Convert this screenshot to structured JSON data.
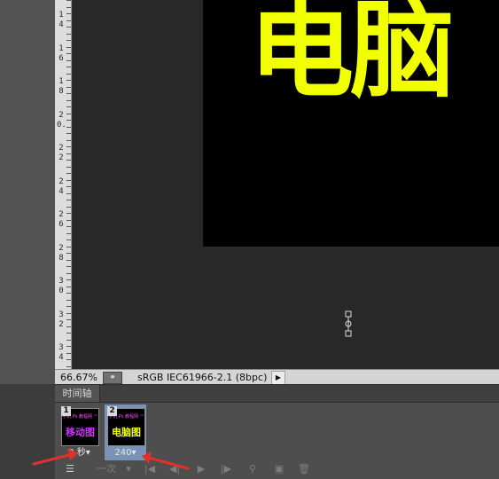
{
  "ruler": {
    "numbers": [
      {
        "a": "1",
        "b": "4"
      },
      {
        "a": "1",
        "b": "6"
      },
      {
        "a": "1",
        "b": "8"
      },
      {
        "a": "2",
        "b": "0."
      },
      {
        "a": "2",
        "b": "2"
      },
      {
        "a": "2",
        "b": "4"
      },
      {
        "a": "2",
        "b": "6"
      },
      {
        "a": "2",
        "b": "8"
      },
      {
        "a": "3",
        "b": "0"
      },
      {
        "a": "3",
        "b": "2"
      },
      {
        "a": "3",
        "b": "4"
      }
    ]
  },
  "canvas": {
    "text": "电脑",
    "text_color": "#f2ff00",
    "background": "#000000"
  },
  "status": {
    "zoom": "66.67%",
    "profile": "sRGB IEC61966-2.1 (8bpc)",
    "icon": "status-link-icon",
    "arrow_glyph": "▶"
  },
  "timeline": {
    "tab_label": "时间轴",
    "frames": [
      {
        "number": "1",
        "thumb_small": "手机 Ps 教程网 ™",
        "thumb_big": "移动图",
        "thumb_color": "#cc33ff",
        "delay": "0 秒▾"
      },
      {
        "number": "2",
        "thumb_small": "手机 Ps 教程网 ™",
        "thumb_big": "电脑图",
        "thumb_color": "#f2ff00",
        "delay": "240▾"
      }
    ],
    "toolbar": {
      "loop_label": "一次",
      "loop_arrow": "▾",
      "first_frame": "|◀",
      "prev_frame": "◀|",
      "play": "▶",
      "next_frame": "|▶",
      "tween": "tween-icon",
      "duplicate": "duplicate-frame-icon",
      "delete": "trash-icon",
      "convert": "convert-timeline-icon"
    }
  },
  "annotations": {
    "arrow_color": "#e0312a"
  }
}
